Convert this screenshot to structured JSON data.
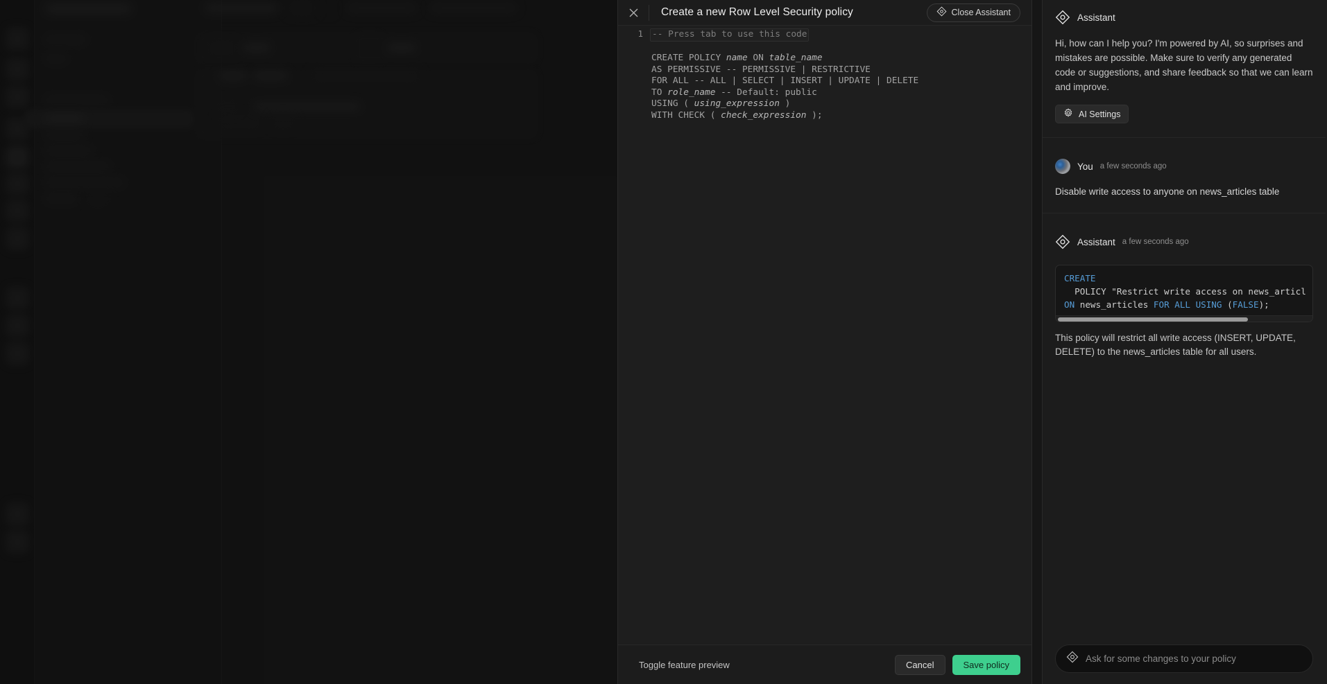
{
  "backdrop": {
    "description": "blurred Supabase dashboard behind modal"
  },
  "modal": {
    "close_icon": "close-icon",
    "title": "Create a new Row Level Security policy",
    "close_assistant_label": "Close Assistant",
    "close_assistant_icon": "assistant-diamond-icon"
  },
  "editor": {
    "line_number": "1",
    "ghost_hint": "-- Press tab to use this code",
    "template_lines": [
      {
        "text": "CREATE POLICY ",
        "italic": "name",
        "text2": " ON ",
        "italic2": "table_name",
        "text3": ""
      },
      {
        "text": "AS PERMISSIVE -- PERMISSIVE | RESTRICTIVE"
      },
      {
        "text": "FOR ALL -- ALL | SELECT | INSERT | UPDATE | DELETE"
      },
      {
        "text": "TO ",
        "italic": "role_name",
        "text2": " -- Default: public"
      },
      {
        "text": "USING ( ",
        "italic": "using_expression",
        "text2": " )"
      },
      {
        "text": "WITH CHECK ( ",
        "italic": "check_expression",
        "text2": " );"
      }
    ]
  },
  "footer": {
    "toggle_label": "Toggle feature preview",
    "cancel_label": "Cancel",
    "save_label": "Save policy",
    "save_color": "#3ecf8e"
  },
  "assistant": {
    "header_title": "Assistant",
    "header_icon": "assistant-diamond-icon",
    "greeting": "Hi, how can I help you? I'm powered by AI, so surprises and mistakes are possible. Make sure to verify any generated code or suggestions, and share feedback so that we can learn and improve.",
    "ai_settings_label": "AI Settings",
    "ai_settings_icon": "gear-icon",
    "messages": [
      {
        "author": "You",
        "time": "a few seconds ago",
        "avatar": "user-avatar",
        "text": "Disable write access to anyone on news_articles table"
      },
      {
        "author": "Assistant",
        "time": "a few seconds ago",
        "avatar": "assistant-diamond-icon",
        "code_line1_kw": "CREATE",
        "code_line2": "  POLICY \"Restrict write access on news_articl",
        "code_line3_kw1": "ON",
        "code_line3_mid": " news_articles ",
        "code_line3_kw2": "FOR ALL USING ",
        "code_line3_paren": "(",
        "code_line3_kw3": "FALSE",
        "code_line3_end": ");",
        "explanation": "This policy will restrict all write access (INSERT, UPDATE, DELETE) to the news_articles table for all users."
      }
    ],
    "input_placeholder": "Ask for some changes to your policy",
    "input_icon": "assistant-diamond-icon",
    "input_value": ""
  }
}
